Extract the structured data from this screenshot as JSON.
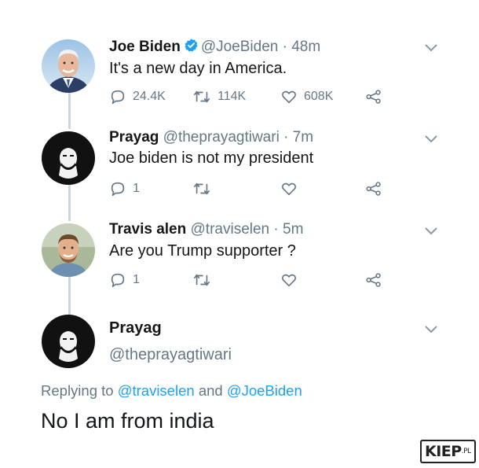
{
  "tweets": [
    {
      "name": "Joe Biden",
      "handle": "@JoeBiden",
      "time": "· 48m",
      "text": "It's a new day in America.",
      "replies": "24.4K",
      "retweets": "114K",
      "likes": "608K",
      "verified": true
    },
    {
      "name": "Prayag",
      "handle": "@theprayagtiwari",
      "time": "· 7m",
      "text": "Joe biden is not my president",
      "replies": "1",
      "retweets": "",
      "likes": ""
    },
    {
      "name": "Travis alen",
      "handle": "@traviselen",
      "time": "· 5m",
      "text": "Are you Trump supporter ?",
      "replies": "1",
      "retweets": "",
      "likes": ""
    }
  ],
  "focused_tweet": {
    "name": "Prayag",
    "handle": "@theprayagtiwari",
    "replying_prefix": "Replying to",
    "reply_to_1": "@traviselen",
    "reply_and": "and",
    "reply_to_2": "@JoeBiden",
    "text": "No I am from india"
  },
  "watermark": {
    "main": "KIEP",
    "suffix": ".PL"
  },
  "colors": {
    "verified": "#1da1f2",
    "link": "#1da1f2",
    "muted": "#657786",
    "line": "#ccd6dd"
  },
  "icons": [
    "reply-icon",
    "retweet-icon",
    "like-icon",
    "share-icon",
    "chevron-down-icon",
    "verified-badge-icon"
  ]
}
